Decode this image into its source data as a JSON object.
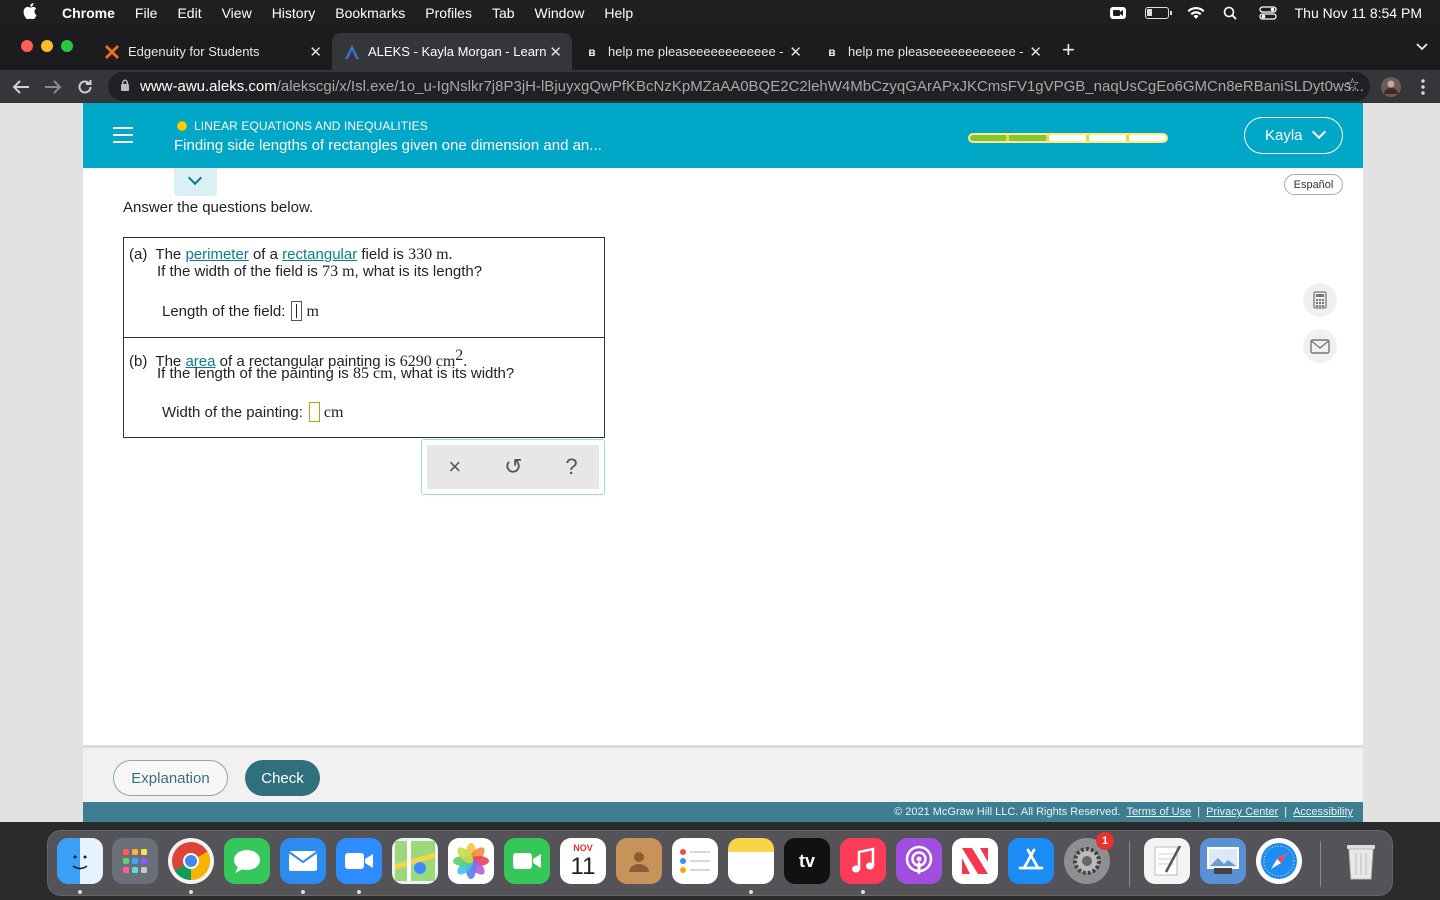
{
  "menubar": {
    "app": "Chrome",
    "items": [
      "File",
      "Edit",
      "View",
      "History",
      "Bookmarks",
      "Profiles",
      "Tab",
      "Window",
      "Help"
    ],
    "clock": "Thu Nov 11  8:54 PM"
  },
  "tabs": [
    {
      "title": "Edgenuity for Students",
      "active": false
    },
    {
      "title": "ALEKS - Kayla Morgan - Learn",
      "active": true
    },
    {
      "title": "help me pleaseeeeeeeeeeee -",
      "active": false
    },
    {
      "title": "help me pleaseeeeeeeeeeee -",
      "active": false
    }
  ],
  "address": {
    "host": "www-awu.aleks.com",
    "path": "/alekscgi/x/Isl.exe/1o_u-IgNslkr7j8P3jH-lBjuyxgQwPfKBcNzKpMZaAA0BQE2C2lehW4MbCzyqGArAPxJKCmsFV1gVPGB_naqUsCgEo6GMCn8eRBaniSLDyt0ws..."
  },
  "aleks": {
    "topic": "LINEAR EQUATIONS AND INEQUALITIES",
    "lesson": "Finding side lengths of rectangles given one dimension and an...",
    "user": "Kayla",
    "espanol": "Español",
    "progress_fraction": 0.4,
    "instructions": "Answer the questions below.",
    "part_a": {
      "label": "(a)",
      "t1": "The ",
      "link1": "perimeter",
      "t2": " of a ",
      "link2": "rectangular",
      "t3": " field is ",
      "value": "330 m.",
      "line2_a": "If the width of the field is ",
      "line2_val": "73 m",
      "line2_b": ", what is its length?",
      "answer_label": "Length of the field:",
      "answer_unit": "m",
      "answer_value": ""
    },
    "part_b": {
      "label": "(b)",
      "t1": "The ",
      "link1": "area",
      "t2": " of a rectangular painting is ",
      "value": "6290 cm",
      "exponent": "2",
      "value_end": ".",
      "line2_a": "If the length of the painting is ",
      "line2_val": "85 cm",
      "line2_b": ", what is its width?",
      "answer_label": "Width of the painting:",
      "answer_unit": "cm",
      "answer_value": ""
    },
    "tools": {
      "clear": "×",
      "undo": "↺",
      "help": "?"
    },
    "buttons": {
      "explanation": "Explanation",
      "check": "Check"
    },
    "footer": {
      "copyright": "© 2021 McGraw Hill LLC. All Rights Reserved.",
      "terms": "Terms of Use",
      "privacy": "Privacy Center",
      "accessibility": "Accessibility",
      "sep": "|"
    }
  },
  "dock": {
    "calendar_month": "NOV",
    "calendar_day": "11",
    "tv_label": "tv",
    "settings_badge": "1"
  },
  "colors": {
    "header": "#00a7c6",
    "link": "#0a7d9b",
    "check_button": "#2f6f7e",
    "progress_fill": "#86c440"
  }
}
